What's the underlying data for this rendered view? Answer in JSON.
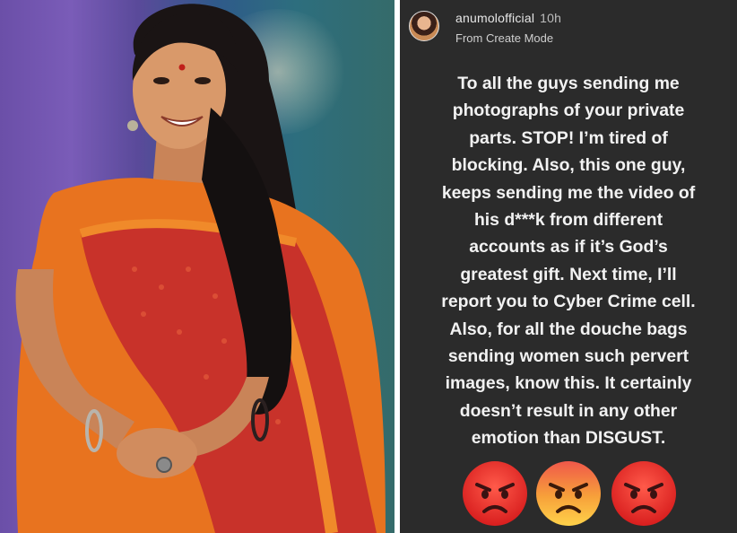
{
  "story": {
    "username": "anumolofficial",
    "time_ago": "10h",
    "mode_label": "From Create Mode",
    "message_lines": [
      "To all the guys sending me",
      "photographs of your private",
      "parts. STOP! I’m tired of",
      "blocking. Also, this one guy,",
      "keeps sending me the video of",
      "his d***k from different",
      "accounts as if it’s God’s",
      "greatest gift. Next time, I’ll",
      "report you to Cyber Crime cell.",
      "Also, for all the douche bags",
      "sending women such pervert",
      "images, know this. It certainly",
      "doesn’t result in any other",
      "emotion than DISGUST."
    ],
    "emojis": [
      "angry-face-icon",
      "angry-face-icon",
      "angry-face-icon"
    ]
  },
  "colors": {
    "story_background": "#2b2b2b",
    "story_text": "#f2f2f2",
    "saree_orange": "#e8731f",
    "saree_red": "#c8322a"
  }
}
